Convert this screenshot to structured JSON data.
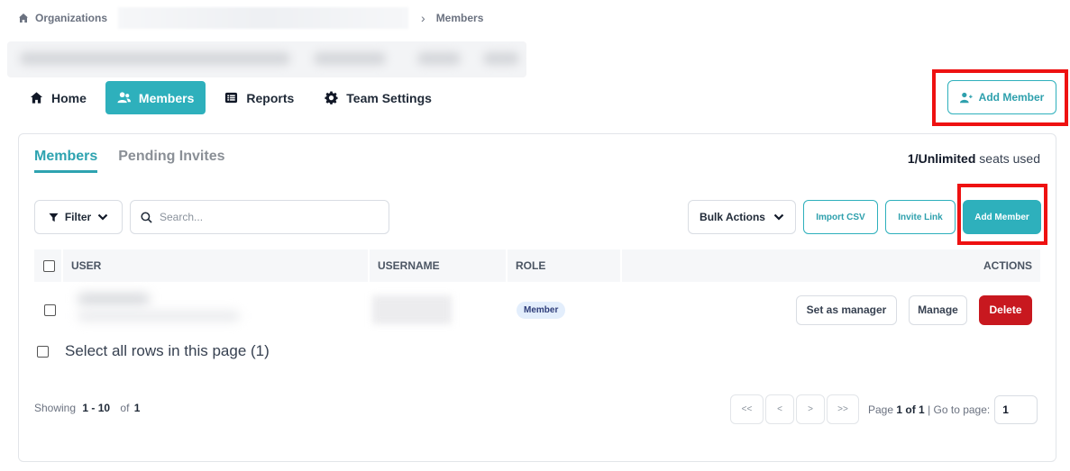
{
  "breadcrumb": {
    "root": "Organizations",
    "current": "Members"
  },
  "nav": {
    "items": [
      {
        "label": "Home",
        "icon": "home-icon",
        "active": false
      },
      {
        "label": "Members",
        "icon": "users-icon",
        "active": true
      },
      {
        "label": "Reports",
        "icon": "list-icon",
        "active": false
      },
      {
        "label": "Team Settings",
        "icon": "gear-icon",
        "active": false
      }
    ]
  },
  "header_actions": {
    "add_member_label": "Add Member"
  },
  "tabs": {
    "members": "Members",
    "pending": "Pending Invites"
  },
  "seats": {
    "count": "1/Unlimited",
    "suffix": "seats used"
  },
  "toolbar": {
    "filter_label": "Filter",
    "search_placeholder": "Search...",
    "bulk_label": "Bulk Actions",
    "import_label": "Import CSV",
    "invite_label": "Invite Link",
    "add_member_label": "Add Member"
  },
  "table": {
    "columns": {
      "user": "USER",
      "username": "USERNAME",
      "role": "ROLE",
      "actions": "ACTIONS"
    },
    "rows": [
      {
        "role": "Member",
        "actions": {
          "set_manager": "Set as manager",
          "manage": "Manage",
          "delete": "Delete"
        }
      }
    ],
    "select_all_label": "Select all rows in this page (1)"
  },
  "footer": {
    "showing_label": "Showing",
    "range": "1 - 10",
    "of_label": "of",
    "total": "1"
  },
  "pagination": {
    "first": "<<",
    "prev": "<",
    "next": ">",
    "last": ">>",
    "page_label": "Page",
    "page_of": "1 of 1",
    "goto_label": "| Go to page:",
    "goto_value": "1"
  },
  "colors": {
    "accent": "#2eb0bc",
    "danger": "#c8181f",
    "highlight": "#ee1111"
  }
}
